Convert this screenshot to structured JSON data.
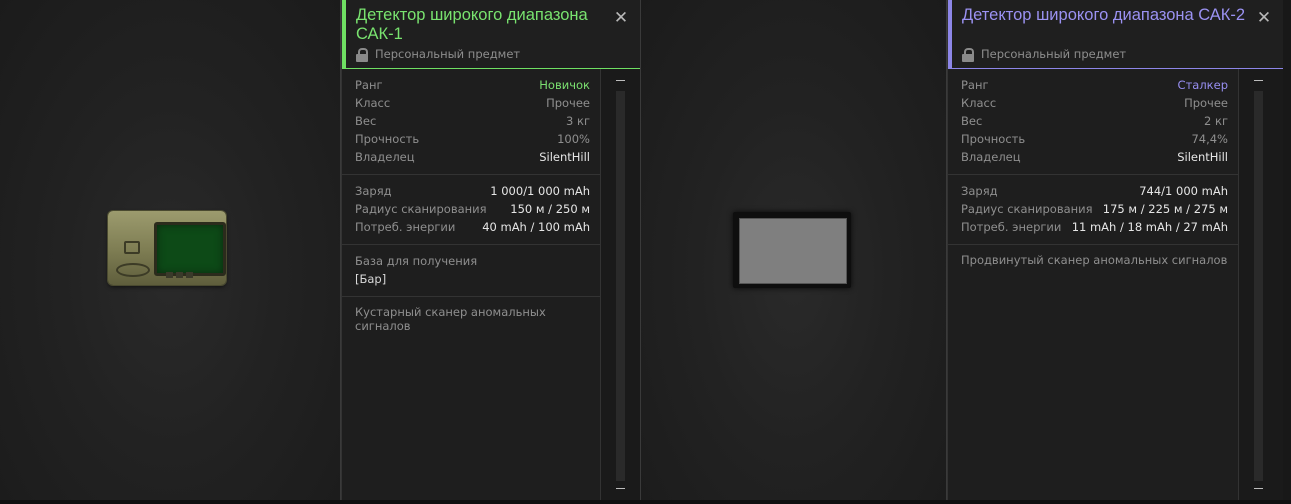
{
  "items": [
    {
      "title": "Детектор широкого диапазона САК-1",
      "personal": "Персональный предмет",
      "rows1": [
        {
          "k": "Ранг",
          "v": "Новичок"
        },
        {
          "k": "Класс",
          "v": "Прочее"
        },
        {
          "k": "Вес",
          "v": "3 кг"
        },
        {
          "k": "Прочность",
          "v": "100%"
        },
        {
          "k": "Владелец",
          "v": "SilentHill"
        }
      ],
      "rows2": [
        {
          "k": "Заряд",
          "v": "1 000/1 000 mAh"
        },
        {
          "k": "Радиус сканирования",
          "v": "150 м / 250 м"
        },
        {
          "k": "Потреб. энергии",
          "v": "40 mAh / 100 mAh"
        }
      ],
      "obtain_label": "База для получения",
      "obtain_value": "[Бар]",
      "description": "Кустарный сканер аномальных сигналов",
      "rank_color": "#7be170"
    },
    {
      "title": "Детектор широкого диапазона САК-2",
      "personal": "Персональный предмет",
      "rows1": [
        {
          "k": "Ранг",
          "v": "Сталкер"
        },
        {
          "k": "Класс",
          "v": "Прочее"
        },
        {
          "k": "Вес",
          "v": "2 кг"
        },
        {
          "k": "Прочность",
          "v": "74,4%"
        },
        {
          "k": "Владелец",
          "v": "SilentHill"
        }
      ],
      "rows2": [
        {
          "k": "Заряд",
          "v": "744/1 000 mAh"
        },
        {
          "k": "Радиус сканирования",
          "v": "175 м / 225 м / 275 м"
        },
        {
          "k": "Потреб. энергии",
          "v": "11 mAh / 18 mAh / 27 mAh"
        }
      ],
      "description": "Продвинутый сканер аномальных сигналов",
      "rank_color": "#978ef0"
    }
  ],
  "icons": {
    "close": "close-icon",
    "lock": "lock-icon",
    "detector1": "detector-sak1-icon",
    "detector2": "detector-sak2-placeholder-icon"
  }
}
